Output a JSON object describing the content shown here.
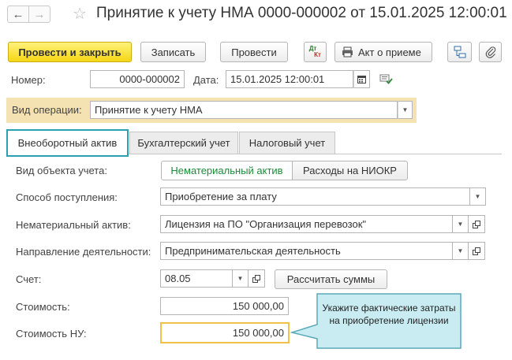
{
  "window": {
    "title": "Принятие к учету НМА 0000-000002 от 15.01.2025 12:00:01"
  },
  "toolbar": {
    "post_and_close": "Провести и закрыть",
    "save": "Записать",
    "post": "Провести",
    "dtkt_top": "Дт",
    "dtkt_bottom": "Кт",
    "act_label": "Акт о приеме"
  },
  "header": {
    "number_label": "Номер:",
    "number_value": "0000-000002",
    "date_label": "Дата:",
    "date_value": "15.01.2025 12:00:01"
  },
  "operation": {
    "label": "Вид операции:",
    "value": "Принятие к учету НМА"
  },
  "tabs": [
    {
      "label": "Внеоборотный актив"
    },
    {
      "label": "Бухгалтерский учет"
    },
    {
      "label": "Налоговый учет"
    }
  ],
  "form": {
    "object_type_label": "Вид объекта учета:",
    "object_type_options": [
      "Нематериальный актив",
      "Расходы на НИОКР"
    ],
    "receipt_method_label": "Способ поступления:",
    "receipt_method_value": "Приобретение за плату",
    "intangible_label": "Нематериальный актив:",
    "intangible_value": "Лицензия на ПО \"Организация перевозок\"",
    "activity_label": "Направление деятельности:",
    "activity_value": "Предпринимательская деятельность",
    "account_label": "Счет:",
    "account_value": "08.05",
    "calc_button": "Рассчитать суммы",
    "cost_label": "Стоимость:",
    "cost_value": "150 000,00",
    "tax_cost_label": "Стоимость НУ:",
    "tax_cost_value": "150 000,00"
  },
  "callout": {
    "text": "Укажите фактические затраты на приобретение лицензии"
  },
  "colors": {
    "accent_teal": "#2d9fb3",
    "primary_yellow": "#f5d616",
    "highlight_beige": "#f5e2b3",
    "callout_bg": "#c8ecf2",
    "active_toggle_text": "#1e8a3a",
    "focus_gold": "#f0c24a"
  }
}
